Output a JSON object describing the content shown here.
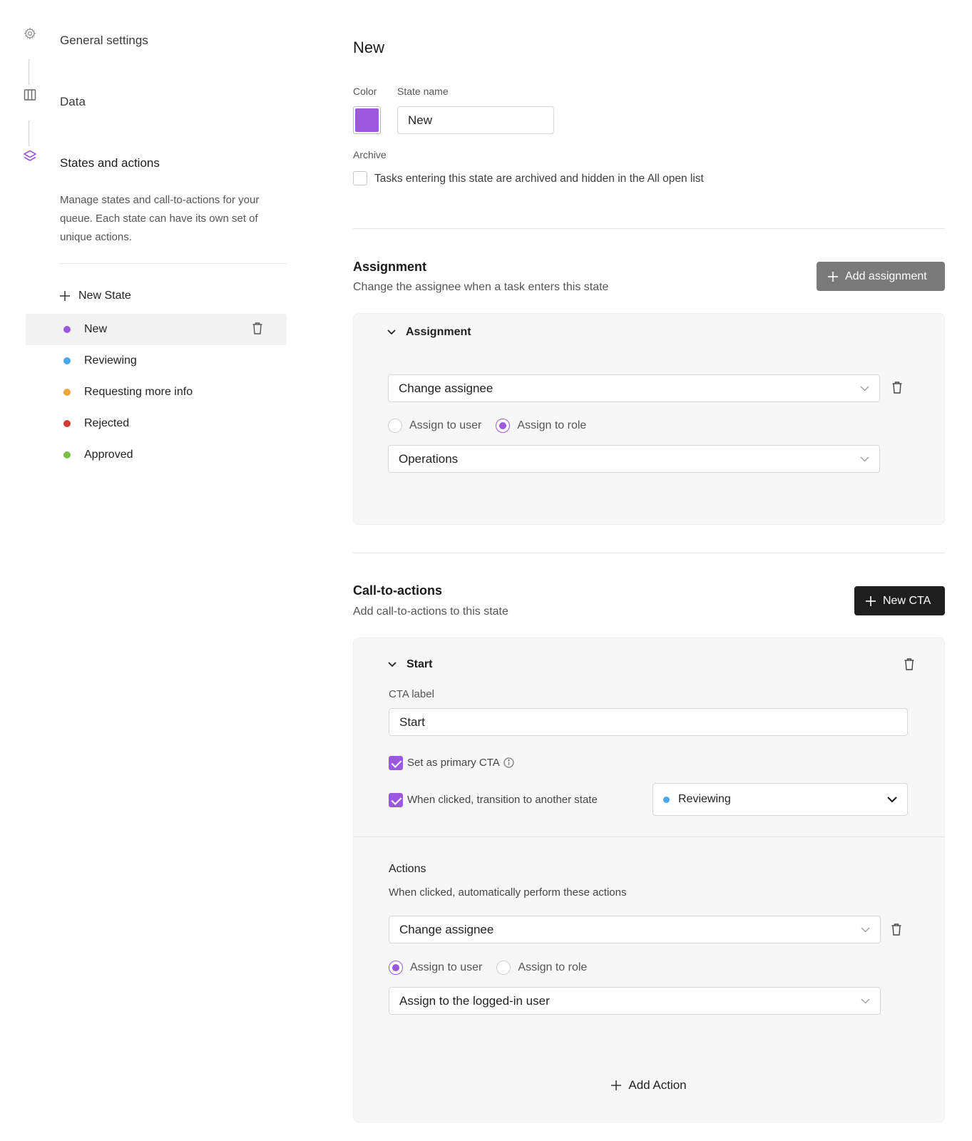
{
  "colors": {
    "accent": "#9b59e0",
    "state_new": "#9b59e0",
    "state_reviewing": "#4aa8f0",
    "state_requesting": "#f4a63c",
    "state_rejected": "#d23c32",
    "state_approved": "#7ac142"
  },
  "sidebar": {
    "steps": [
      {
        "label": "General settings",
        "icon": "gear-icon"
      },
      {
        "label": "Data",
        "icon": "columns-icon"
      },
      {
        "label": "States and actions",
        "icon": "layers-icon"
      }
    ],
    "description": "Manage states and call-to-actions for your queue. Each state can have its own set of unique actions.",
    "new_state_label": "New State",
    "states": [
      {
        "name": "New",
        "color": "#9b59e0",
        "active": true
      },
      {
        "name": "Reviewing",
        "color": "#4aa8f0",
        "active": false
      },
      {
        "name": "Requesting more info",
        "color": "#f4a63c",
        "active": false
      },
      {
        "name": "Rejected",
        "color": "#d23c32",
        "active": false
      },
      {
        "name": "Approved",
        "color": "#7ac142",
        "active": false
      }
    ]
  },
  "main": {
    "title": "New",
    "color_label": "Color",
    "state_name_label": "State name",
    "state_name_value": "New",
    "archive_label": "Archive",
    "archive_checkbox_text": "Tasks entering this state are archived and hidden in the All open list",
    "assignment": {
      "title": "Assignment",
      "subtitle": "Change the assignee when a task enters this state",
      "add_button": "Add assignment",
      "panel_title": "Assignment",
      "action_select": "Change assignee",
      "radio_user": "Assign to user",
      "radio_role": "Assign to role",
      "selected_radio": "role",
      "role_select": "Operations"
    },
    "cta": {
      "title": "Call-to-actions",
      "subtitle": "Add call-to-actions to this state",
      "new_button": "New CTA",
      "panel_title": "Start",
      "cta_label_label": "CTA label",
      "cta_label_value": "Start",
      "primary_text": "Set as primary CTA",
      "transition_text": "When clicked, transition to another state",
      "transition_state": "Reviewing",
      "actions_title": "Actions",
      "actions_subtitle": "When clicked, automatically perform these actions",
      "action_select": "Change assignee",
      "radio_user": "Assign to user",
      "radio_role": "Assign to role",
      "selected_radio": "user",
      "user_select": "Assign to the logged-in user",
      "add_action": "Add Action"
    }
  }
}
